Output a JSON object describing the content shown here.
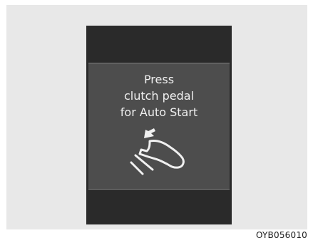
{
  "message": {
    "line1": "Press",
    "line2": "clutch pedal",
    "line3": "for Auto Start"
  },
  "icon": "clutch-pedal-press-icon",
  "figure_code": "OYB056010",
  "colors": {
    "background": "#e8e8e8",
    "display": "#2a2a2a",
    "panel": "#4d4d4d",
    "text": "#f0f0f0"
  }
}
